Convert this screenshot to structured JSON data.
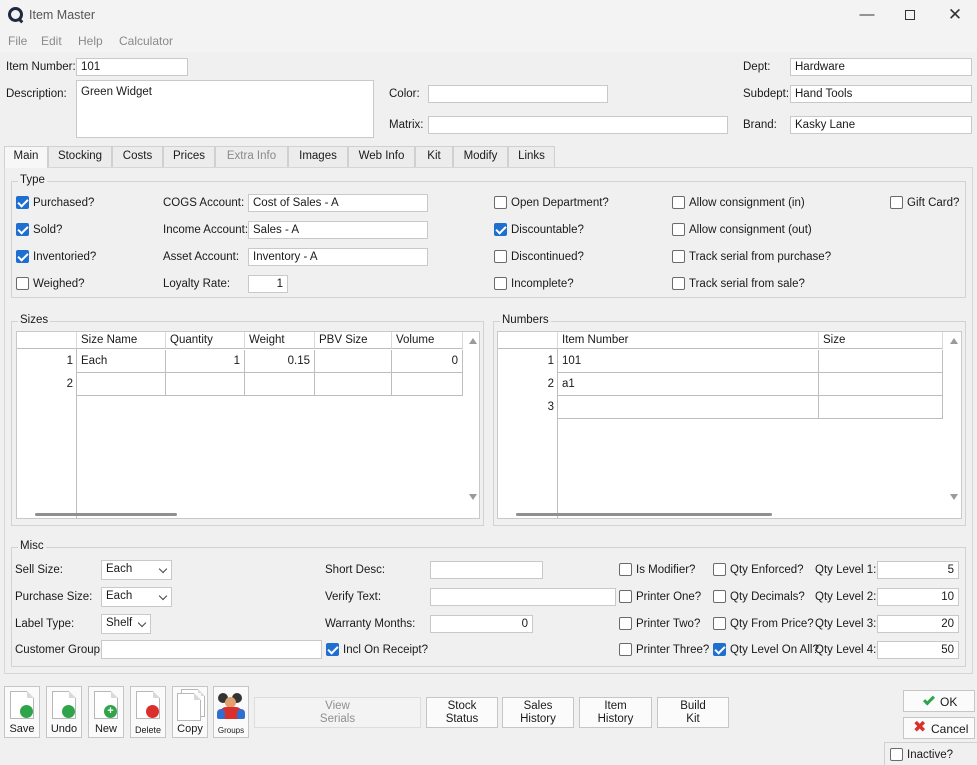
{
  "window": {
    "title": "Item Master"
  },
  "menu": [
    "File",
    "Edit",
    "Help",
    "Calculator"
  ],
  "header": {
    "item_number_label": "Item Number:",
    "item_number": "101",
    "description_label": "Description:",
    "description": "Green Widget",
    "color_label": "Color:",
    "color": "",
    "matrix_label": "Matrix:",
    "matrix": "",
    "dept_label": "Dept:",
    "dept": "Hardware",
    "subdept_label": "Subdept:",
    "subdept": "Hand Tools",
    "brand_label": "Brand:",
    "brand": "Kasky Lane"
  },
  "tabs": [
    "Main",
    "Stocking",
    "Costs",
    "Prices",
    "Extra Info",
    "Images",
    "Web Info",
    "Kit",
    "Modify",
    "Links"
  ],
  "type_group": {
    "title": "Type",
    "purchased": "Purchased?",
    "sold": "Sold?",
    "inventoried": "Inventoried?",
    "weighed": "Weighed?",
    "cogs_label": "COGS Account:",
    "cogs": "Cost of Sales - A",
    "income_label": "Income Account:",
    "income": "Sales - A",
    "asset_label": "Asset Account:",
    "asset": "Inventory - A",
    "loyalty_label": "Loyalty Rate:",
    "loyalty": "1",
    "open_department": "Open Department?",
    "discountable": "Discountable?",
    "discontinued": "Discontinued?",
    "incomplete": "Incomplete?",
    "consign_in": "Allow consignment (in)",
    "consign_out": "Allow consignment (out)",
    "serial_purchase": "Track serial from purchase?",
    "serial_sale": "Track serial from sale?",
    "gift_card": "Gift Card?"
  },
  "sizes": {
    "title": "Sizes",
    "columns": [
      "Size Name",
      "Quantity",
      "Weight",
      "PBV Size",
      "Volume"
    ],
    "rows": [
      {
        "num": "1",
        "name": "Each",
        "qty": "1",
        "weight": "0.15",
        "pbv": "",
        "volume": "0"
      },
      {
        "num": "2",
        "name": "",
        "qty": "",
        "weight": "",
        "pbv": "",
        "volume": ""
      }
    ]
  },
  "numbers": {
    "title": "Numbers",
    "columns": [
      "Item Number",
      "Size"
    ],
    "rows": [
      {
        "num": "1",
        "item": "101",
        "size": ""
      },
      {
        "num": "2",
        "item": "a1",
        "size": ""
      },
      {
        "num": "3",
        "item": "",
        "size": ""
      }
    ]
  },
  "misc": {
    "title": "Misc",
    "sell_size_label": "Sell Size:",
    "sell_size": "Each",
    "purchase_size_label": "Purchase Size:",
    "purchase_size": "Each",
    "label_type_label": "Label Type:",
    "label_type": "Shelf",
    "customer_group_label": "Customer Group:",
    "customer_group": "",
    "short_desc_label": "Short Desc:",
    "short_desc": "",
    "verify_text_label": "Verify Text:",
    "verify_text": "",
    "warranty_label": "Warranty Months:",
    "warranty": "0",
    "incl_receipt": "Incl On Receipt?",
    "is_modifier": "Is Modifier?",
    "printer_one": "Printer One?",
    "printer_two": "Printer Two?",
    "printer_three": "Printer Three?",
    "qty_enforced": "Qty Enforced?",
    "qty_decimals": "Qty Decimals?",
    "qty_from_price": "Qty From Price?",
    "qty_level_all": "Qty Level On All?",
    "qty1_label": "Qty Level 1:",
    "qty1": "5",
    "qty2_label": "Qty Level 2:",
    "qty2": "10",
    "qty3_label": "Qty Level 3:",
    "qty3": "20",
    "qty4_label": "Qty Level 4:",
    "qty4": "50"
  },
  "toolbar": {
    "save": "Save",
    "undo": "Undo",
    "new": "New",
    "delete": "Delete",
    "copy": "Copy",
    "groups": "Groups",
    "view_serials": "View\nSerials",
    "stock_status": "Stock\nStatus",
    "sales_history": "Sales\nHistory",
    "item_history": "Item\nHistory",
    "build_kit": "Build\nKit",
    "ok": "OK",
    "cancel": "Cancel",
    "inactive": "Inactive?"
  }
}
